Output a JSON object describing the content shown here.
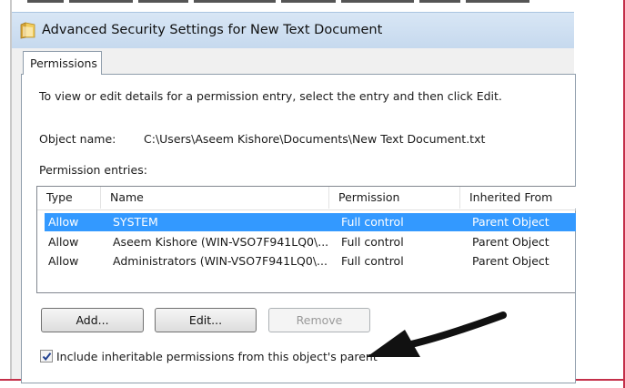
{
  "window": {
    "title": "Advanced Security Settings for New Text Document"
  },
  "tabs": [
    {
      "label": "Permissions",
      "active": true
    }
  ],
  "instructions": "To view or edit details for a permission entry, select the entry and then click Edit.",
  "object": {
    "label": "Object name:",
    "value": "C:\\Users\\Aseem Kishore\\Documents\\New Text Document.txt"
  },
  "entries_label": "Permission entries:",
  "table": {
    "columns": [
      "Type",
      "Name",
      "Permission",
      "Inherited From"
    ],
    "rows": [
      {
        "type": "Allow",
        "name": "SYSTEM",
        "permission": "Full control",
        "inherited": "Parent Object",
        "selected": true
      },
      {
        "type": "Allow",
        "name": "Aseem Kishore (WIN-VSO7F941LQ0\\...",
        "permission": "Full control",
        "inherited": "Parent Object",
        "selected": false
      },
      {
        "type": "Allow",
        "name": "Administrators (WIN-VSO7F941LQ0\\...",
        "permission": "Full control",
        "inherited": "Parent Object",
        "selected": false
      }
    ]
  },
  "buttons": {
    "add": "Add...",
    "edit": "Edit...",
    "remove": "Remove"
  },
  "inherit_checkbox": {
    "label": "Include inheritable permissions from this object's parent",
    "checked": true
  },
  "colors": {
    "selection": "#3399ff",
    "frame_accent": "#c4304a",
    "titlebar": "#c6d9ee"
  },
  "icons": [
    "folder-icon",
    "checkmark-icon",
    "arrow-annotation-icon"
  ]
}
